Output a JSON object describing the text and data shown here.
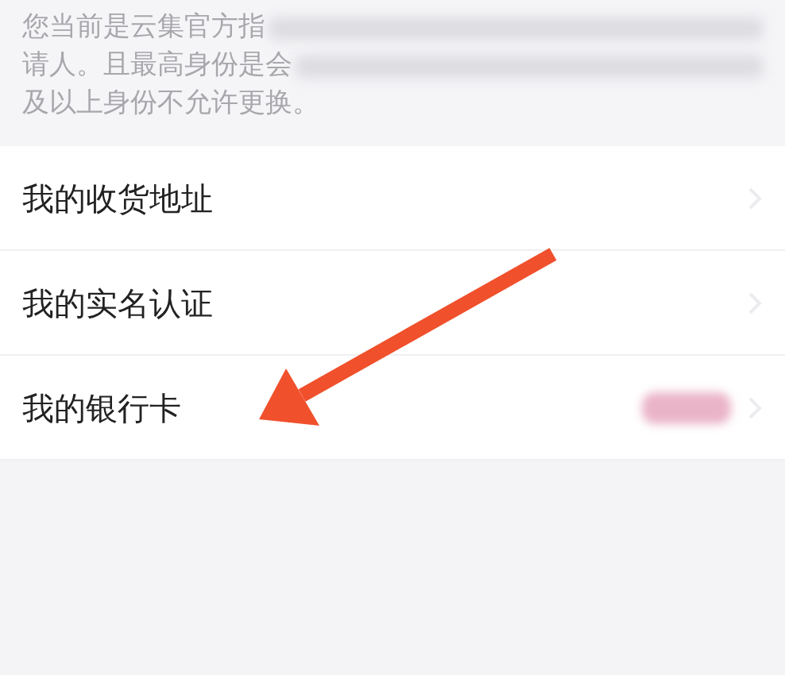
{
  "notice": {
    "lines": [
      {
        "text": "您当前是云集官方指",
        "blurred_tail": true
      },
      {
        "text": "请人。且最高身份是会",
        "blurred_tail": true
      },
      {
        "text": "及以上身份不允许更换。",
        "blurred_tail": false
      }
    ]
  },
  "menu": [
    {
      "label": "我的收货地址",
      "badge": false
    },
    {
      "label": "我的实名认证",
      "badge": false
    },
    {
      "label": "我的银行卡",
      "badge": true
    }
  ]
}
